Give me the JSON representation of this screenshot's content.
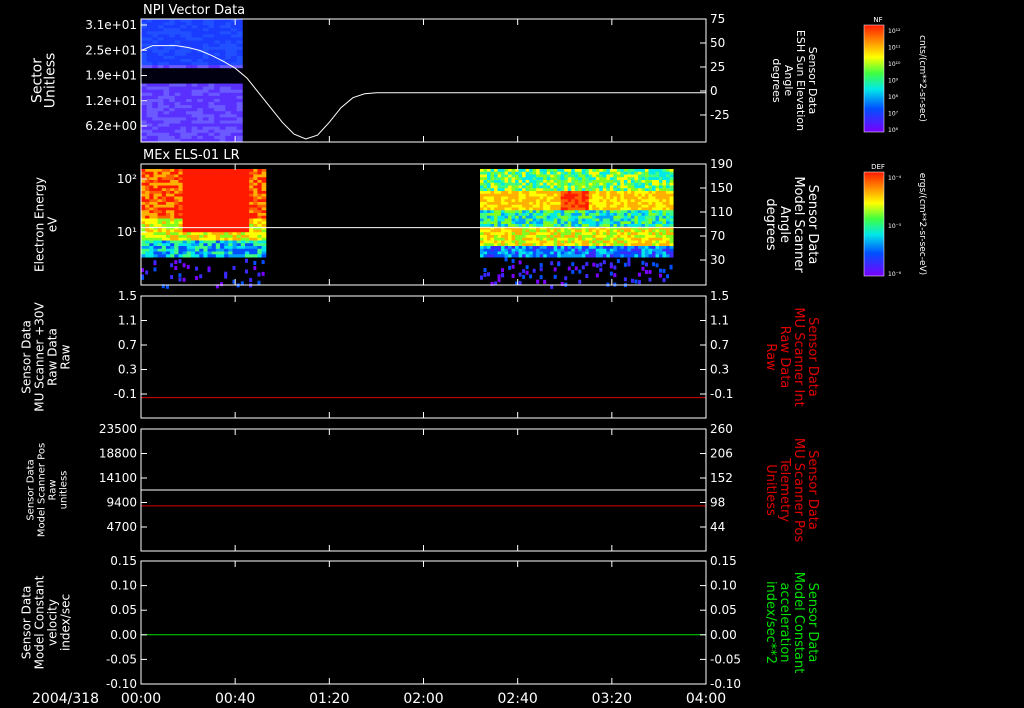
{
  "date_label": "2004/318",
  "time_ticks": [
    "00:00",
    "00:40",
    "01:20",
    "02:00",
    "02:40",
    "03:20",
    "04:00"
  ],
  "colors": {
    "background": "#000000",
    "axis": "#ffffff",
    "red_series": "#e00000",
    "green_series": "#00e000"
  },
  "colorbars": [
    {
      "title": "NF",
      "unit": "cnts/(cm**2-sr-sec)",
      "ticks": [
        "10¹²",
        "10¹¹",
        "10¹⁰",
        "10⁹",
        "10⁸",
        "10⁷",
        "10⁶"
      ]
    },
    {
      "title": "DEF",
      "unit": "ergs/(cm**2-sr-sec-eV)",
      "ticks": [
        "10⁻⁴",
        "10⁻⁵",
        "10⁻⁶"
      ]
    }
  ],
  "chart_data": [
    {
      "type": "heatmap",
      "title": "NPI Vector Data",
      "left_label": [
        "Sector",
        "Unitless"
      ],
      "left_ticks": [
        "3.1e+01",
        "2.5e+01",
        "1.9e+01",
        "1.2e+01",
        "6.2e+00"
      ],
      "right_label": [
        "Sensor Data",
        "ESH Sun Elevation",
        "Angle",
        "degrees"
      ],
      "right_ticks": [
        "75",
        "50",
        "25",
        "0",
        "-25"
      ],
      "right_ylim": [
        -50,
        75
      ],
      "xlim_minutes": [
        0,
        240
      ],
      "data_span_minutes": [
        0,
        43
      ],
      "line_series": {
        "name": "ESH Sun Elevation Angle",
        "t": [
          0,
          5,
          10,
          15,
          20,
          25,
          30,
          35,
          40,
          45,
          50,
          55,
          60,
          65,
          70,
          75,
          80,
          85,
          90,
          95,
          100,
          110,
          240
        ],
        "v": [
          43,
          48,
          48,
          48,
          46,
          43,
          38,
          32,
          25,
          15,
          0,
          -15,
          -30,
          -42,
          -47,
          -43,
          -30,
          -15,
          -5,
          -1,
          0,
          0,
          0
        ]
      }
    },
    {
      "type": "heatmap",
      "title": "MEx ELS-01 LR",
      "left_label": [
        "Electron Energy",
        "eV"
      ],
      "left_ticks": [
        "10²",
        "10¹"
      ],
      "right_label": [
        "Sensor Data",
        "Model Scanner",
        "Angle",
        "degrees"
      ],
      "right_ticks": [
        "190",
        "150",
        "110",
        "70",
        "30"
      ],
      "right_ylim": [
        0,
        190
      ],
      "data_spans_minutes": [
        [
          0,
          53
        ],
        [
          144,
          226
        ]
      ],
      "line_series": {
        "name": "Model Scanner Angle",
        "value": 90
      }
    },
    {
      "type": "line",
      "left_label": [
        "Sensor Data",
        "MU Scanner +30V",
        "Raw Data",
        "Raw"
      ],
      "left_ticks": [
        "1.5",
        "1.1",
        "0.7",
        "0.3",
        "-0.1"
      ],
      "right_label": [
        "Sensor Data",
        "MU Scanner Int",
        "Raw Data",
        "Raw"
      ],
      "right_ticks": [
        "1.5",
        "1.1",
        "0.7",
        "0.3",
        "-0.1"
      ],
      "ylim": [
        -0.3,
        1.5
      ],
      "series": [
        {
          "name": "MU Scanner Int Raw Data",
          "color": "red",
          "value": 0.0
        }
      ]
    },
    {
      "type": "line",
      "left_label": [
        "Sensor Data",
        "Model Scanner Pos",
        "Raw",
        "unitless"
      ],
      "left_ticks": [
        "23500",
        "18800",
        "14100",
        "9400",
        "4700"
      ],
      "right_label": [
        "Sensor Data",
        "MU Scanner Pos",
        "Telemetry",
        "Unitless"
      ],
      "right_ticks": [
        "260",
        "206",
        "152",
        "98",
        "44"
      ],
      "left_ylim": [
        0,
        23500
      ],
      "right_ylim": [
        -10,
        260
      ],
      "series": [
        {
          "name": "Model Scanner Pos Raw",
          "color": "white",
          "axis": "left",
          "value": 11750
        },
        {
          "name": "MU Scanner Pos Telemetry",
          "color": "red",
          "axis": "right",
          "value": 90
        }
      ]
    },
    {
      "type": "line",
      "left_label": [
        "Sensor Data",
        "Model Constant",
        "velocity",
        "index/sec"
      ],
      "left_ticks": [
        "0.15",
        "0.10",
        "0.05",
        "0.00",
        "-0.05",
        "-0.10"
      ],
      "right_label": [
        "Sensor Data",
        "Model Constant",
        "acceleration",
        "index/sec**2"
      ],
      "right_ticks": [
        "0.15",
        "0.10",
        "0.05",
        "0.00",
        "-0.05",
        "-0.10"
      ],
      "ylim": [
        -0.1,
        0.15
      ],
      "series": [
        {
          "name": "Model Constant",
          "color": "green",
          "value": 0.0
        }
      ]
    }
  ]
}
